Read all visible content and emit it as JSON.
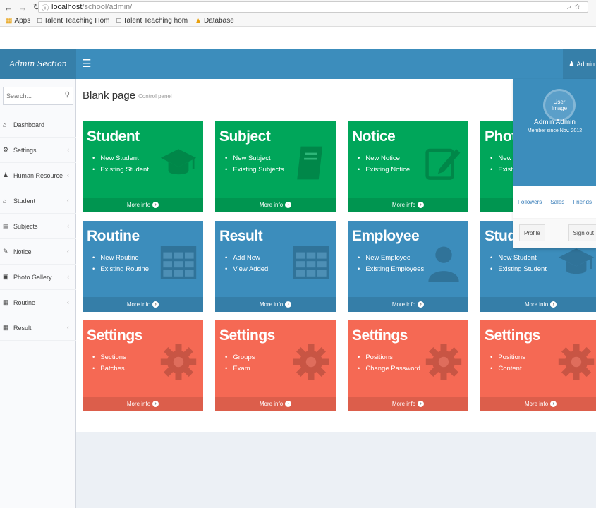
{
  "browser": {
    "back_icon": "arrow-left-icon",
    "url_host": "localhost",
    "url_path": "/school/admin/",
    "bookmarks": [
      "Apps",
      "Talent Teaching Hom",
      "Talent Teaching hom",
      "Database"
    ]
  },
  "header": {
    "logo": "Admin Section",
    "user": "Admin"
  },
  "sidebar": {
    "search_placeholder": "Search...",
    "items": [
      {
        "label": "Dashboard",
        "icon": "dashboard-icon",
        "chevron": false
      },
      {
        "label": "Settings",
        "icon": "gear-icon",
        "chevron": true
      },
      {
        "label": "Human Resource",
        "icon": "user-icon",
        "chevron": true
      },
      {
        "label": "Student",
        "icon": "graduation-cap-icon",
        "chevron": true
      },
      {
        "label": "Subjects",
        "icon": "book-icon",
        "chevron": true
      },
      {
        "label": "Notice",
        "icon": "edit-icon",
        "chevron": true
      },
      {
        "label": "Photo Gallery",
        "icon": "image-icon",
        "chevron": true
      },
      {
        "label": "Routine",
        "icon": "table-icon",
        "chevron": true
      },
      {
        "label": "Result",
        "icon": "table-icon",
        "chevron": true
      }
    ]
  },
  "content": {
    "title": "Blank page",
    "subtitle": "Control panel",
    "more_info": "More info",
    "tiles": [
      {
        "title": "Student",
        "color": "#00a65a",
        "icon": "graduation-cap-icon",
        "items": [
          "New Student",
          "Existing Student"
        ]
      },
      {
        "title": "Subject",
        "color": "#00a65a",
        "icon": "book-icon",
        "items": [
          "New Subject",
          "Existing Subjects"
        ]
      },
      {
        "title": "Notice",
        "color": "#00a65a",
        "icon": "edit-icon",
        "items": [
          "New Notice",
          "Existing Notice"
        ]
      },
      {
        "title": "Photo",
        "color": "#00a65a",
        "icon": "image-icon",
        "items": [
          "New G",
          "Existi"
        ]
      },
      {
        "title": "Routine",
        "color": "#3c8dbc",
        "icon": "table-icon",
        "items": [
          "New Routine",
          "Existing Routine"
        ]
      },
      {
        "title": "Result",
        "color": "#3c8dbc",
        "icon": "table-icon",
        "items": [
          "Add New",
          "View Added"
        ]
      },
      {
        "title": "Employee",
        "color": "#3c8dbc",
        "icon": "user-icon",
        "items": [
          "New Employee",
          "Existing Employees"
        ]
      },
      {
        "title": "Stude",
        "color": "#3c8dbc",
        "icon": "graduation-cap-icon",
        "items": [
          "New Student",
          "Existing Student"
        ]
      },
      {
        "title": "Settings",
        "color": "#f56954",
        "icon": "gear-icon",
        "items": [
          "Sections",
          "Batches"
        ]
      },
      {
        "title": "Settings",
        "color": "#f56954",
        "icon": "gear-icon",
        "items": [
          "Groups",
          "Exam"
        ]
      },
      {
        "title": "Settings",
        "color": "#f56954",
        "icon": "gear-icon",
        "items": [
          "Positions",
          "Change Password"
        ]
      },
      {
        "title": "Settings",
        "color": "#f56954",
        "icon": "gear-icon",
        "items": [
          "Positions",
          "Content"
        ]
      }
    ]
  },
  "user_menu": {
    "image_alt": "User Image",
    "name": "Admin Admin",
    "member_since": "Member since Nov. 2012",
    "links": [
      "Followers",
      "Sales",
      "Friends"
    ],
    "profile_button": "Profile",
    "signout_button": "Sign out"
  }
}
